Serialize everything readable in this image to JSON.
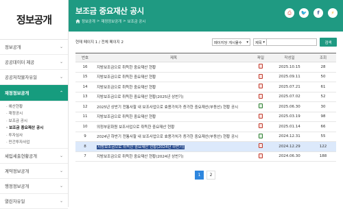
{
  "sidebar": {
    "logo": "정보공개",
    "items": [
      "정보공개",
      "공공데이터 제공",
      "공공저작물자유일",
      "재정정보공개",
      "세입세출현황공개",
      "계약정보공개",
      "행정정보공개",
      "열린자유일"
    ],
    "active_index": 3,
    "submenu": [
      "예산현황",
      "재정공시",
      "보조금 공시",
      "보조금 중요재산 공시",
      "투자심사",
      "민간투자사업"
    ],
    "current_sub_index": 3
  },
  "header": {
    "title": "보조금 중요재산 공시",
    "breadcrumb": [
      "정보공개",
      "재정정보공개",
      "보조금 공시"
    ],
    "accent": "#1f9a82"
  },
  "toolbar": {
    "page_info": "현재 페이지 1 / 전체 페이지 2",
    "page_size_select": "페이지당 게시물수",
    "field_select": "제목",
    "search_value": "",
    "search_label": "검색"
  },
  "table": {
    "headers": [
      "번호",
      "제목",
      "파일",
      "작성일",
      "조회"
    ],
    "rows": [
      {
        "no": "16",
        "title": "지방보조금으로 취득한 중요재산 현황",
        "file": "hwp-red",
        "date": "2025.10.15",
        "views": "28"
      },
      {
        "no": "15",
        "title": "지방보조금으로 취득한 중요재산 현황",
        "file": "hwp-red",
        "date": "2025.09.11",
        "views": "50"
      },
      {
        "no": "14",
        "title": "지방보조금으로 취득한 중요재산 현황",
        "file": "hwp-red",
        "date": "2025.07.21",
        "views": "61"
      },
      {
        "no": "13",
        "title": "지방보조금으로 취득한 중요재산 현황(2025년 상반기)",
        "file": "hwp-red",
        "date": "2025.07.02",
        "views": "52"
      },
      {
        "no": "12",
        "title": "2025년 상반기 전통사찰 내 보조사업으로 효용가치가 증가한 중요재산(부동산) 현황 공시",
        "file": "hwp-green",
        "date": "2025.06.30",
        "views": "30"
      },
      {
        "no": "11",
        "title": "지방보조금으로 취득한 중요재산 현황",
        "file": "hwp-red",
        "date": "2025.03.19",
        "views": "98"
      },
      {
        "no": "10",
        "title": "의정부문화원 보조사업으로 취득한 중요재산 현황",
        "file": "hwp-red",
        "date": "2025.01.14",
        "views": "66"
      },
      {
        "no": "9",
        "title": "2024년 하반기 전통사찰 내 보조사업으로 효용가치가 증가한 중요재산(부동산) 현황 공시",
        "file": "hwp-green",
        "date": "2024.12.31",
        "views": "55"
      },
      {
        "no": "8",
        "title": "지방보조금으로 취득한 중요재산 현황(2024년 하반기)",
        "file": "hwp-red",
        "date": "2024.12.29",
        "views": "122",
        "selected": true
      },
      {
        "no": "7",
        "title": "지방보조금으로 취득한 중요재산 현황(2024년 상반기)",
        "file": "hwp-red",
        "date": "2024.06.30",
        "views": "188"
      }
    ]
  },
  "pagination": {
    "pages": [
      "1",
      "2"
    ],
    "current": "1"
  }
}
